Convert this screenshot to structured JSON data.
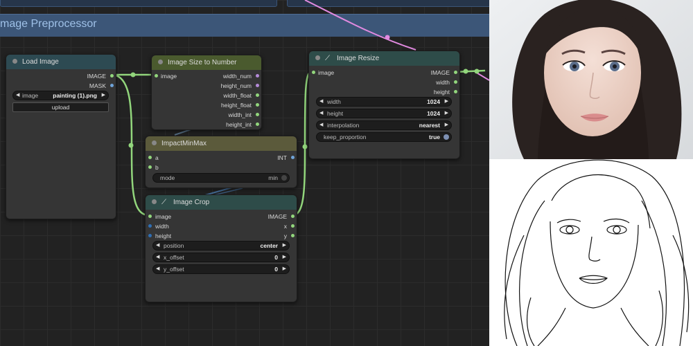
{
  "group": {
    "title": "mage Preprocessor"
  },
  "colors": {
    "connected_wire": "#92d67c",
    "image_wire": "#e18ae0"
  },
  "nodes": {
    "load_image": {
      "title": "Load Image",
      "outputs": [
        "IMAGE",
        "MASK"
      ],
      "image_widget": {
        "label": "image",
        "value": "painting (1).png"
      },
      "upload_button": "upload"
    },
    "image_size": {
      "title": "Image Size to Number",
      "input": "image",
      "outputs": [
        "width_num",
        "height_num",
        "width_float",
        "height_float",
        "width_int",
        "height_int"
      ]
    },
    "minmax": {
      "title": "ImpactMinMax",
      "inputs": [
        "a",
        "b"
      ],
      "output": "INT",
      "mode_widget": {
        "label": "mode",
        "value": "min"
      }
    },
    "image_crop": {
      "title": "Image Crop",
      "inputs": [
        "image",
        "width",
        "height"
      ],
      "outputs": [
        "IMAGE",
        "x",
        "y"
      ],
      "widgets": [
        {
          "label": "position",
          "value": "center"
        },
        {
          "label": "x_offset",
          "value": "0"
        },
        {
          "label": "y_offset",
          "value": "0"
        }
      ]
    },
    "image_resize": {
      "title": "Image Resize",
      "input": "image",
      "outputs": [
        "IMAGE",
        "width",
        "height"
      ],
      "widgets": [
        {
          "label": "width",
          "value": "1024"
        },
        {
          "label": "height",
          "value": "1024"
        },
        {
          "label": "interpolation",
          "value": "nearest"
        }
      ],
      "keep_proportion": {
        "label": "keep_proportion",
        "value": "true"
      }
    }
  }
}
